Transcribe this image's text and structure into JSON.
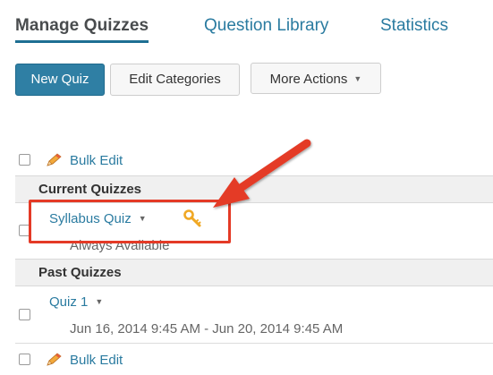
{
  "tabs": [
    {
      "label": "Manage Quizzes",
      "active": true
    },
    {
      "label": "Question Library",
      "active": false
    },
    {
      "label": "Statistics",
      "active": false
    }
  ],
  "toolbar": {
    "new_quiz_label": "New Quiz",
    "edit_categories_label": "Edit Categories",
    "more_actions_label": "More Actions"
  },
  "bulk_edit_label": "Bulk Edit",
  "sections": [
    {
      "title": "Current Quizzes",
      "quizzes": [
        {
          "name": "Syllabus Quiz",
          "availability": "Always Available",
          "icon": "key-icon"
        }
      ]
    },
    {
      "title": "Past Quizzes",
      "quizzes": [
        {
          "name": "Quiz 1",
          "availability": "Jun 16, 2014 9:45 AM - Jun 20, 2014 9:45 AM"
        }
      ]
    }
  ],
  "colors": {
    "primary": "#2f7fa4",
    "link": "#2a7ba0",
    "annotation": "#e43a26",
    "key": "#f0a824"
  }
}
